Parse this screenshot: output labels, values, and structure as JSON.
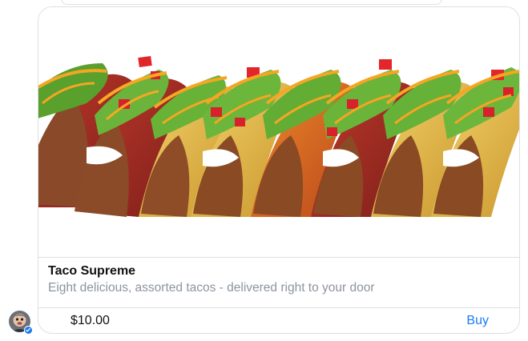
{
  "product": {
    "title": "Taco Supreme",
    "subtitle": "Eight delicious, assorted tacos - delivered right to your door",
    "price": "$10.00",
    "action_label": "Buy"
  },
  "image": {
    "icon": "tacos-photo"
  },
  "colors": {
    "accent": "#1b7cf2",
    "border": "#dcdfe3",
    "subtitle": "#8d949e"
  }
}
